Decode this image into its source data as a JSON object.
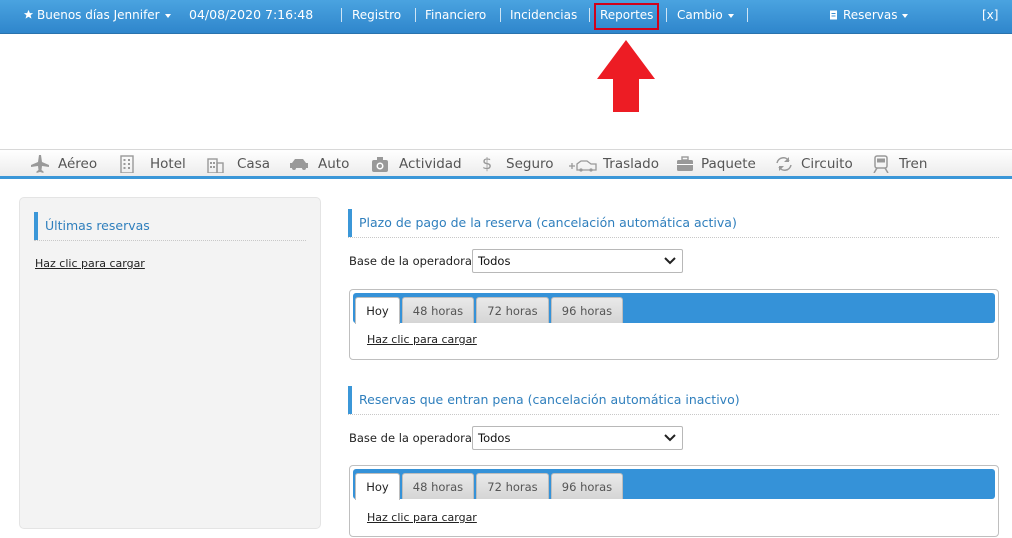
{
  "topbar": {
    "greeting": "Buenos días Jennifer",
    "datetime": "04/08/2020 7:16:48",
    "menu": [
      "Registro",
      "Financiero",
      "Incidencias",
      "Reportes"
    ],
    "cambio": "Cambio",
    "reservas": "Reservas",
    "close": "[x]",
    "greeting_icon": "star-icon",
    "reservas_icon": "document-icon"
  },
  "products": [
    {
      "label": "Aéreo",
      "icon": "plane-icon"
    },
    {
      "label": "Hotel",
      "icon": "building-icon"
    },
    {
      "label": "Casa",
      "icon": "house-icon"
    },
    {
      "label": "Auto",
      "icon": "car-icon"
    },
    {
      "label": "Actividad",
      "icon": "camera-icon"
    },
    {
      "label": "Seguro",
      "icon": "dollar-icon"
    },
    {
      "label": "Traslado",
      "icon": "transfer-icon"
    },
    {
      "label": "Paquete",
      "icon": "suitcase-icon"
    },
    {
      "label": "Circuito",
      "icon": "circuit-icon"
    },
    {
      "label": "Tren",
      "icon": "train-icon"
    }
  ],
  "sidebar": {
    "title": "Últimas reservas",
    "link": "Haz clic para cargar"
  },
  "section1": {
    "title": "Plazo de pago de la reserva (cancelación automática activa)",
    "operator_label": "Base de la operadora",
    "operator_value": "Todos",
    "tabs": [
      "Hoy",
      "48 horas",
      "72 horas",
      "96 horas"
    ],
    "link": "Haz clic para cargar"
  },
  "section2": {
    "title": "Reservas que entran pena (cancelación automática inactivo)",
    "operator_label": "Base de la operadora",
    "operator_value": "Todos",
    "tabs": [
      "Hoy",
      "48 horas",
      "72 horas",
      "96 horas"
    ],
    "link": "Haz clic para cargar"
  },
  "colors": {
    "topbar": "#3592d8",
    "accent": "#3b97d8",
    "highlight": "#d0021b",
    "arrow": "#ed1c24"
  }
}
